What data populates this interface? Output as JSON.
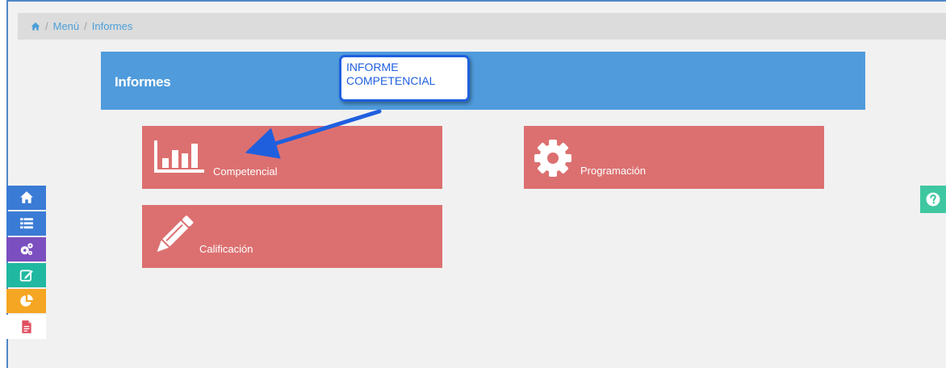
{
  "breadcrumb": {
    "menu": "Menú",
    "reports": "Informes",
    "separator": "/"
  },
  "header": {
    "title": "Informes"
  },
  "callout": {
    "line1": "INFORME",
    "line2": "COMPETENCIAL"
  },
  "tiles": [
    {
      "label": "Competencial",
      "icon": "bar-chart-icon"
    },
    {
      "label": "Programación",
      "icon": "gear-icon"
    },
    {
      "label": "Calificación",
      "icon": "pencil-icon"
    }
  ],
  "side_menu": [
    {
      "icon": "home-icon",
      "color": "#3a7bd5"
    },
    {
      "icon": "list-icon",
      "color": "#3a7bd5"
    },
    {
      "icon": "gears-icon",
      "color": "#7b4fbf"
    },
    {
      "icon": "edit-icon",
      "color": "#20b8a0"
    },
    {
      "icon": "pie-chart-icon",
      "color": "#f5a623"
    },
    {
      "icon": "document-icon",
      "color": "#ffffff"
    }
  ],
  "colors": {
    "tile": "#dc7070",
    "header": "#4f9bdc",
    "breadcrumb_link": "#4a9fd8",
    "callout_border": "#1f5fde",
    "help_button": "#3ec7a0"
  }
}
